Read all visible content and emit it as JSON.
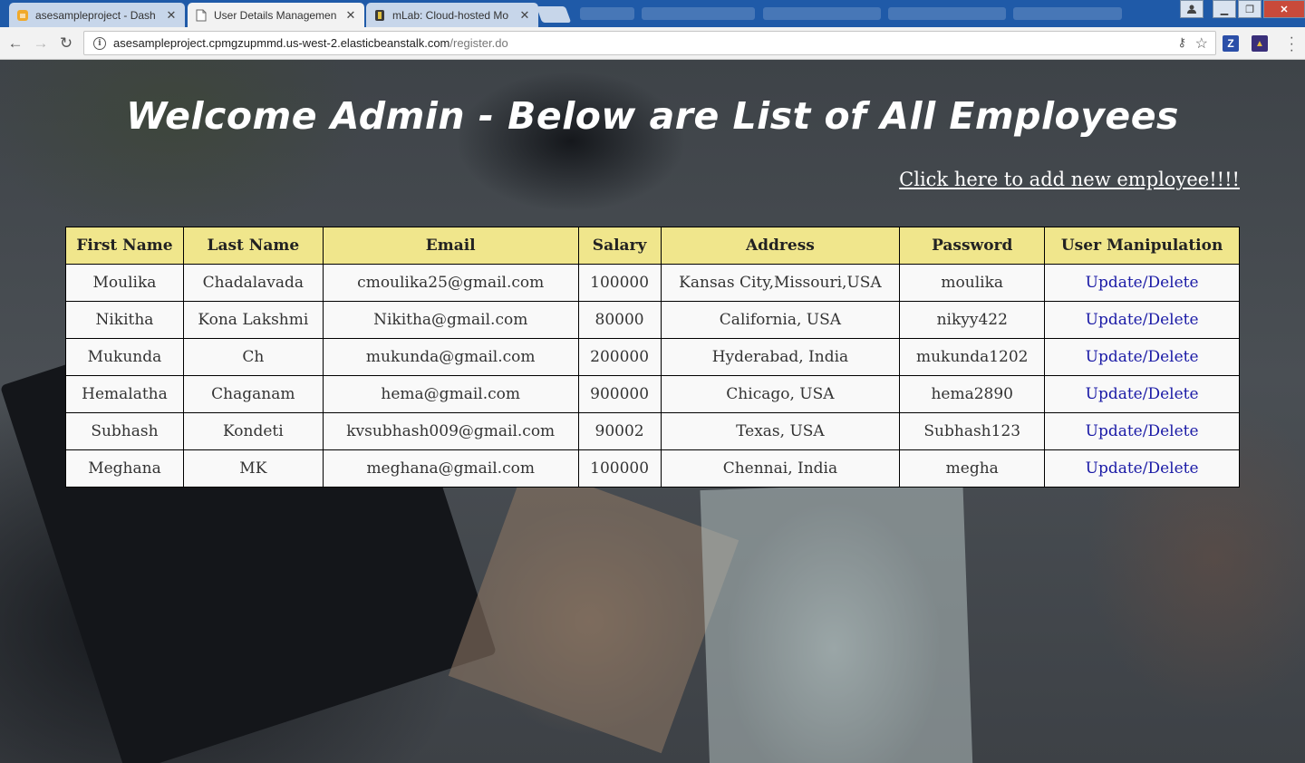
{
  "browser": {
    "tabs": [
      {
        "title": "asesampleproject - Dash",
        "active": false,
        "favicon": "aws-icon"
      },
      {
        "title": "User Details Managemen",
        "active": true,
        "favicon": "page-icon"
      },
      {
        "title": "mLab: Cloud-hosted Mo",
        "active": false,
        "favicon": "mlab-icon"
      }
    ],
    "url_host": "asesampleproject.cpmgzupmmd.us-west-2.elasticbeanstalk.com",
    "url_path": "/register.do",
    "extensions": [
      {
        "name": "zotero-icon",
        "label": "Z",
        "color": "#2b4fa8"
      },
      {
        "name": "bookmark-extension-icon",
        "label": "▲",
        "color": "#3a2f7a"
      }
    ]
  },
  "page": {
    "title": "Welcome Admin - Below are List of All Employees",
    "add_link": "Click here to add new employee!!!!"
  },
  "table": {
    "headers": [
      "First Name",
      "Last Name",
      "Email",
      "Salary",
      "Address",
      "Password",
      "User Manipulation"
    ],
    "rows": [
      [
        "Moulika",
        "Chadalavada",
        "cmoulika25@gmail.com",
        "100000",
        "Kansas City,Missouri,USA",
        "moulika",
        "Update/Delete"
      ],
      [
        "Nikitha",
        "Kona Lakshmi",
        "Nikitha@gmail.com",
        "80000",
        "California, USA",
        "nikyy422",
        "Update/Delete"
      ],
      [
        "Mukunda",
        "Ch",
        "mukunda@gmail.com",
        "200000",
        "Hyderabad, India",
        "mukunda1202",
        "Update/Delete"
      ],
      [
        "Hemalatha",
        "Chaganam",
        "hema@gmail.com",
        "900000",
        "Chicago, USA",
        "hema2890",
        "Update/Delete"
      ],
      [
        "Subhash",
        "Kondeti",
        "kvsubhash009@gmail.com",
        "90002",
        "Texas, USA",
        "Subhash123",
        "Update/Delete"
      ],
      [
        "Meghana",
        "MK",
        "meghana@gmail.com",
        "100000",
        "Chennai, India",
        "megha",
        "Update/Delete"
      ]
    ]
  },
  "colors": {
    "header_bg": "#f0e68c",
    "link": "#1a1aa6",
    "tabstrip": "#1f5aa8"
  }
}
